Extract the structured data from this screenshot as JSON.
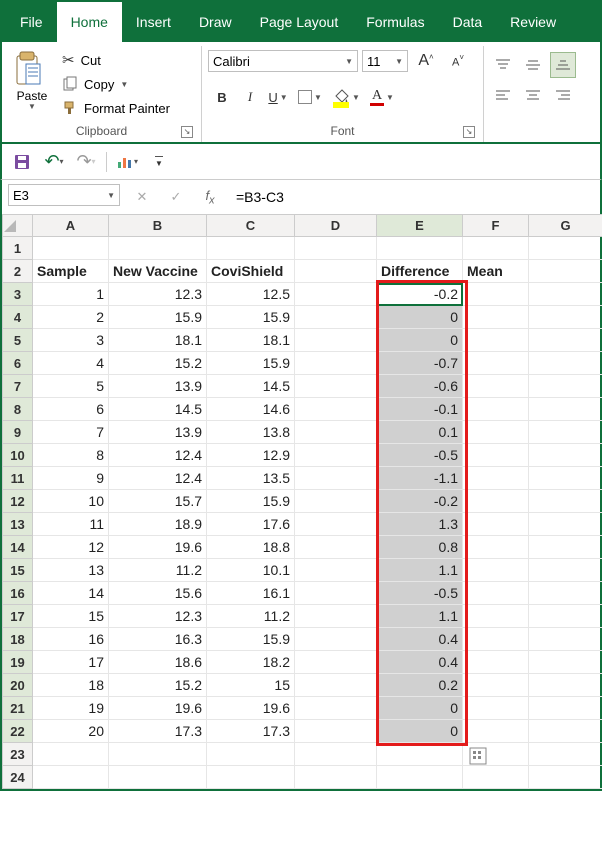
{
  "tabs": {
    "file": "File",
    "home": "Home",
    "insert": "Insert",
    "draw": "Draw",
    "page_layout": "Page Layout",
    "formulas": "Formulas",
    "data": "Data",
    "review": "Review"
  },
  "ribbon": {
    "clipboard": {
      "paste": "Paste",
      "cut": "Cut",
      "copy": "Copy",
      "format_painter": "Format Painter",
      "group_label": "Clipboard"
    },
    "font": {
      "name": "Calibri",
      "size": "11",
      "group_label": "Font"
    }
  },
  "formula_bar": {
    "cell_ref": "E3",
    "formula": "=B3-C3"
  },
  "columns": [
    "A",
    "B",
    "C",
    "D",
    "E",
    "F",
    "G"
  ],
  "headers": {
    "A": "Sample",
    "B": "New Vaccine",
    "C": "CoviShield",
    "E": "Difference",
    "F": "Mean"
  },
  "rows": [
    {
      "n": 1,
      "A": "1",
      "B": "12.3",
      "C": "12.5",
      "E": "-0.2"
    },
    {
      "n": 2,
      "A": "2",
      "B": "15.9",
      "C": "15.9",
      "E": "0"
    },
    {
      "n": 3,
      "A": "3",
      "B": "18.1",
      "C": "18.1",
      "E": "0"
    },
    {
      "n": 4,
      "A": "4",
      "B": "15.2",
      "C": "15.9",
      "E": "-0.7"
    },
    {
      "n": 5,
      "A": "5",
      "B": "13.9",
      "C": "14.5",
      "E": "-0.6"
    },
    {
      "n": 6,
      "A": "6",
      "B": "14.5",
      "C": "14.6",
      "E": "-0.1"
    },
    {
      "n": 7,
      "A": "7",
      "B": "13.9",
      "C": "13.8",
      "E": "0.1"
    },
    {
      "n": 8,
      "A": "8",
      "B": "12.4",
      "C": "12.9",
      "E": "-0.5"
    },
    {
      "n": 9,
      "A": "9",
      "B": "12.4",
      "C": "13.5",
      "E": "-1.1"
    },
    {
      "n": 10,
      "A": "10",
      "B": "15.7",
      "C": "15.9",
      "E": "-0.2"
    },
    {
      "n": 11,
      "A": "11",
      "B": "18.9",
      "C": "17.6",
      "E": "1.3"
    },
    {
      "n": 12,
      "A": "12",
      "B": "19.6",
      "C": "18.8",
      "E": "0.8"
    },
    {
      "n": 13,
      "A": "13",
      "B": "11.2",
      "C": "10.1",
      "E": "1.1"
    },
    {
      "n": 14,
      "A": "14",
      "B": "15.6",
      "C": "16.1",
      "E": "-0.5"
    },
    {
      "n": 15,
      "A": "15",
      "B": "12.3",
      "C": "11.2",
      "E": "1.1"
    },
    {
      "n": 16,
      "A": "16",
      "B": "16.3",
      "C": "15.9",
      "E": "0.4"
    },
    {
      "n": 17,
      "A": "17",
      "B": "18.6",
      "C": "18.2",
      "E": "0.4"
    },
    {
      "n": 18,
      "A": "18",
      "B": "15.2",
      "C": "15",
      "E": "0.2"
    },
    {
      "n": 19,
      "A": "19",
      "B": "19.6",
      "C": "19.6",
      "E": "0"
    },
    {
      "n": 20,
      "A": "20",
      "B": "17.3",
      "C": "17.3",
      "E": "0"
    }
  ],
  "chart_data": {
    "type": "table",
    "title": "",
    "columns": [
      "Sample",
      "New Vaccine",
      "CoviShield",
      "Difference"
    ],
    "rows": [
      [
        1,
        12.3,
        12.5,
        -0.2
      ],
      [
        2,
        15.9,
        15.9,
        0
      ],
      [
        3,
        18.1,
        18.1,
        0
      ],
      [
        4,
        15.2,
        15.9,
        -0.7
      ],
      [
        5,
        13.9,
        14.5,
        -0.6
      ],
      [
        6,
        14.5,
        14.6,
        -0.1
      ],
      [
        7,
        13.9,
        13.8,
        0.1
      ],
      [
        8,
        12.4,
        12.9,
        -0.5
      ],
      [
        9,
        12.4,
        13.5,
        -1.1
      ],
      [
        10,
        15.7,
        15.9,
        -0.2
      ],
      [
        11,
        18.9,
        17.6,
        1.3
      ],
      [
        12,
        19.6,
        18.8,
        0.8
      ],
      [
        13,
        11.2,
        10.1,
        1.1
      ],
      [
        14,
        15.6,
        16.1,
        -0.5
      ],
      [
        15,
        12.3,
        11.2,
        1.1
      ],
      [
        16,
        16.3,
        15.9,
        0.4
      ],
      [
        17,
        18.6,
        18.2,
        0.4
      ],
      [
        18,
        15.2,
        15,
        0.2
      ],
      [
        19,
        19.6,
        19.6,
        0
      ],
      [
        20,
        17.3,
        17.3,
        0
      ]
    ]
  }
}
